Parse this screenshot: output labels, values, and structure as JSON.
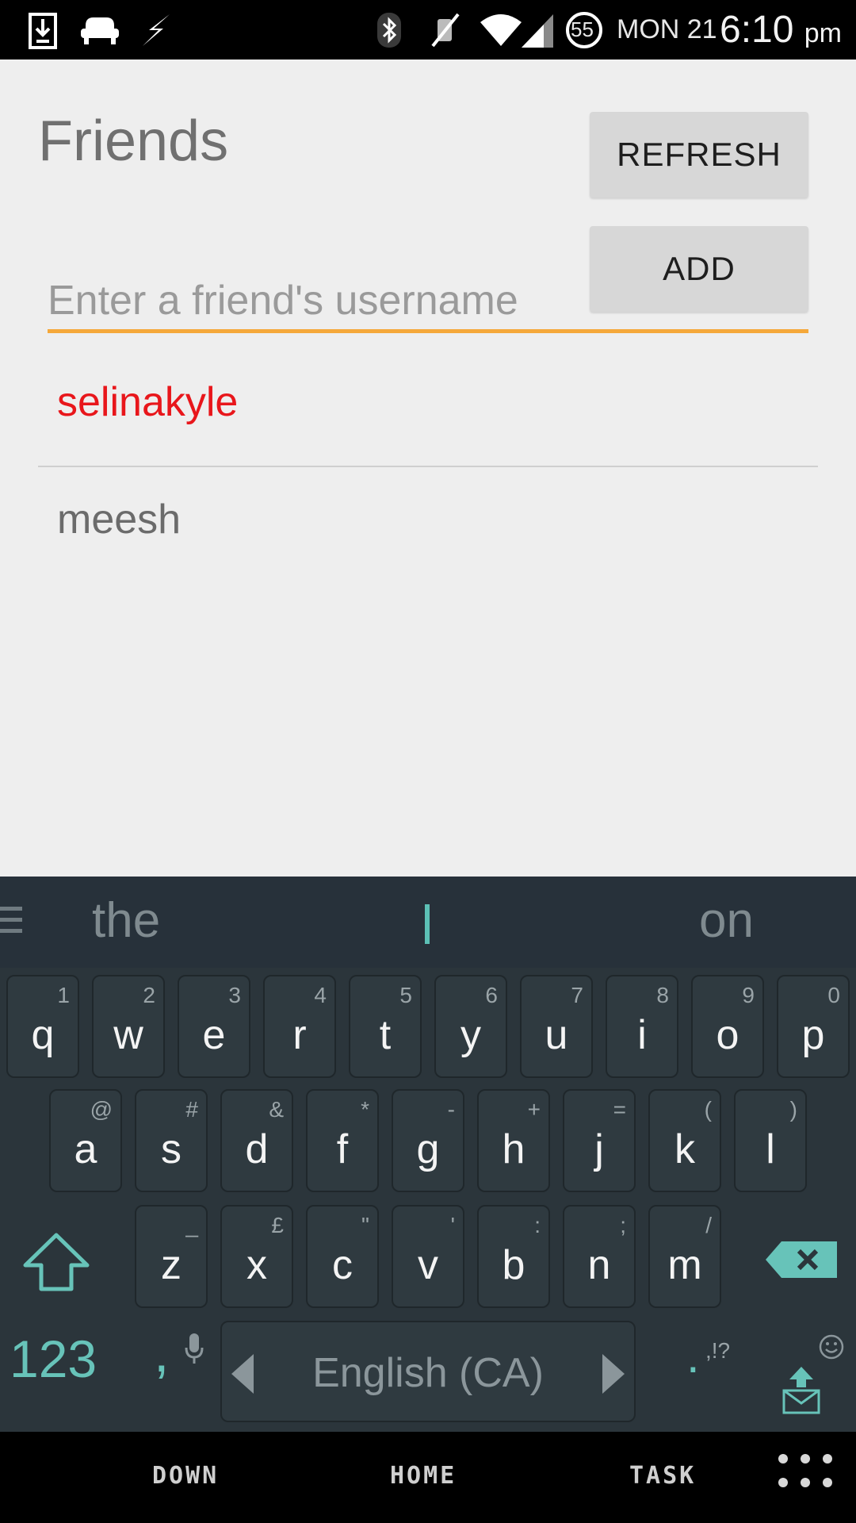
{
  "status_bar": {
    "date": "MON 21",
    "time": "6:10",
    "ampm": "pm",
    "battery": "55",
    "icons": [
      "download-icon",
      "couch-icon",
      "lightning-icon",
      "bluetooth-icon",
      "mute-icon",
      "wifi-icon",
      "signal-icon",
      "battery-icon"
    ]
  },
  "app": {
    "title": "Friends",
    "refresh_label": "REFRESH",
    "add_label": "ADD",
    "input_placeholder": "Enter a friend's username",
    "accent_color": "#f5a83a",
    "friends": [
      {
        "name": "selinakyle",
        "color": "#e8161b"
      },
      {
        "name": "meesh",
        "color": "#6b6b6b"
      }
    ]
  },
  "keyboard": {
    "suggestions": [
      "the",
      "on"
    ],
    "row1": [
      {
        "key": "q",
        "hint": "1"
      },
      {
        "key": "w",
        "hint": "2"
      },
      {
        "key": "e",
        "hint": "3"
      },
      {
        "key": "r",
        "hint": "4"
      },
      {
        "key": "t",
        "hint": "5"
      },
      {
        "key": "y",
        "hint": "6"
      },
      {
        "key": "u",
        "hint": "7"
      },
      {
        "key": "i",
        "hint": "8"
      },
      {
        "key": "o",
        "hint": "9"
      },
      {
        "key": "p",
        "hint": "0"
      }
    ],
    "row2": [
      {
        "key": "a",
        "hint": "@"
      },
      {
        "key": "s",
        "hint": "#"
      },
      {
        "key": "d",
        "hint": "&"
      },
      {
        "key": "f",
        "hint": "*"
      },
      {
        "key": "g",
        "hint": "-"
      },
      {
        "key": "h",
        "hint": "+"
      },
      {
        "key": "j",
        "hint": "="
      },
      {
        "key": "k",
        "hint": "("
      },
      {
        "key": "l",
        "hint": ")"
      }
    ],
    "row3": [
      {
        "key": "z",
        "hint": "_"
      },
      {
        "key": "x",
        "hint": "£"
      },
      {
        "key": "c",
        "hint": "\""
      },
      {
        "key": "v",
        "hint": "'"
      },
      {
        "key": "b",
        "hint": ":"
      },
      {
        "key": "n",
        "hint": ";"
      },
      {
        "key": "m",
        "hint": "/"
      }
    ],
    "numbers_label": "123",
    "comma": ",",
    "space_label": "English (CA)",
    "period": ".",
    "period_hint": ",!?"
  },
  "nav_bar": {
    "down": "DOWN",
    "home": "HOME",
    "task": "TASK"
  }
}
